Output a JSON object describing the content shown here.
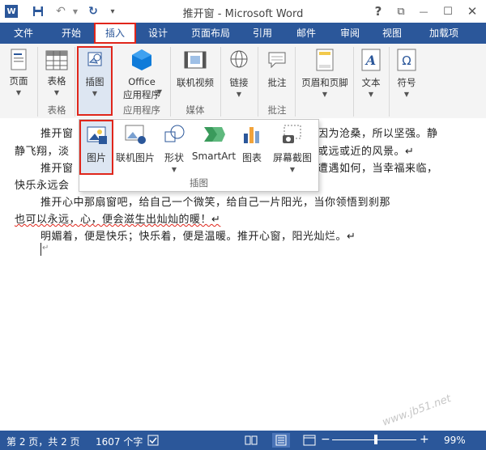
{
  "window": {
    "title": "推开窗 - Microsoft Word"
  },
  "quick_access": {
    "word_icon": "word-app-icon",
    "save_icon": "save-icon",
    "undo_icon": "undo-icon",
    "redo_icon": "redo-icon",
    "customize_icon": "customize-icon"
  },
  "window_controls": {
    "help": "?",
    "restore": "⧉",
    "minimize": "—",
    "maximize": "☐",
    "close": "✕"
  },
  "tabs": [
    "文件",
    "开始",
    "插入",
    "设计",
    "页面布局",
    "引用",
    "邮件",
    "审阅",
    "视图",
    "加载项"
  ],
  "ribbon": {
    "page": "页面",
    "table": "表格",
    "picture": "插图",
    "office_apps_line1": "Office",
    "office_apps_line2": "应用程序",
    "online_video": "联机视频",
    "link": "链接",
    "comment": "批注",
    "header_footer": "页眉和页脚",
    "text": "文本",
    "symbol": "符号",
    "groups": {
      "table": "表格",
      "apps": "应用程序",
      "media": "媒体",
      "comments": "批注"
    }
  },
  "gallery": {
    "items": [
      "图片",
      "联机图片",
      "形状",
      "SmartArt",
      "图表",
      "屏幕截图"
    ],
    "group_label": "插图"
  },
  "document": {
    "lines": [
      {
        "indent": true,
        "text": "推开窗",
        "tail": "因为沧桑，所以坚强。静"
      },
      {
        "indent": false,
        "text": "静飞翔，淡",
        "tail": "或远或近的风景。↵"
      },
      {
        "indent": true,
        "text": "推开窗",
        "tail": "遭遇如何，当幸福来临，"
      },
      {
        "indent": false,
        "text": "快乐永远会",
        "tail": ""
      },
      {
        "indent": true,
        "text": "推开心中那扇窗吧，给自己一个微笑，给自己一片阳光，当你领悟到刹那",
        "tail": ""
      },
      {
        "indent": false,
        "text": "也可以永远，心，便会滋生出灿灿的暖！↵",
        "tail": ""
      },
      {
        "indent": true,
        "text": "明媚着，便是快乐；快乐着，便是温暖。推开心窗，阳光灿烂。↵",
        "tail": ""
      }
    ],
    "cursor_mark": "↵"
  },
  "status": {
    "page": "第 2 页，共 2 页",
    "words": "1607 个字",
    "zoom": "99%",
    "zoom_minus": "−",
    "zoom_plus": "+"
  },
  "watermark": "www.jb51.net",
  "colors": {
    "accent": "#2b579a",
    "highlight": "#e0261b"
  }
}
